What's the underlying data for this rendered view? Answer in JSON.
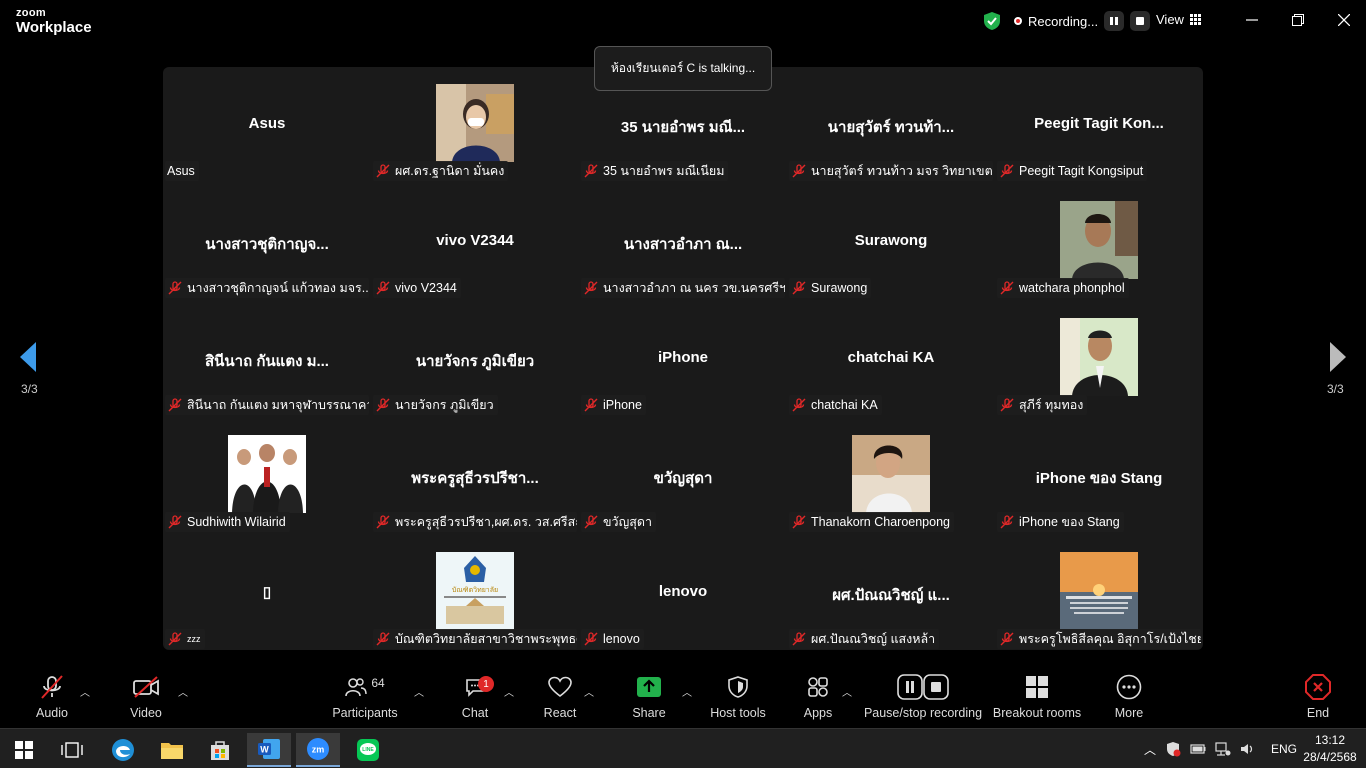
{
  "app": {
    "brand_top": "zoom",
    "brand_bottom": "Workplace"
  },
  "titlebar": {
    "recording_label": "Recording...",
    "view_label": "View"
  },
  "talking": "ห้องเรียนเตอร์ C is talking...",
  "pager": {
    "left": "3/3",
    "right": "3/3"
  },
  "tiles": [
    {
      "display": "Asus",
      "label": "Asus",
      "muted": false,
      "photo": null
    },
    {
      "display": "",
      "label": "ผศ.ดร.ฐานิดา มั่นคง",
      "muted": true,
      "photo": "woman-portrait"
    },
    {
      "display": "35 นายอำพร มณี...",
      "label": "35 นายอำพร มณีเนียม",
      "muted": true,
      "photo": null
    },
    {
      "display": "นายสุวัตร์ ทวนท้า...",
      "label": "นายสุวัตร์ ทวนท้าว มจร วิทยาเขต...",
      "muted": true,
      "photo": null
    },
    {
      "display": "Peegit Tagit Kon...",
      "label": "Peegit Tagit Kongsiput",
      "muted": true,
      "photo": null
    },
    {
      "display": "นางสาวชุติกาญจ...",
      "label": "นางสาวชุติกาญจน์ แก้วทอง มจร....",
      "muted": true,
      "photo": null
    },
    {
      "display": "vivo V2344",
      "label": "vivo V2344",
      "muted": true,
      "photo": null
    },
    {
      "display": "นางสาวอำภา ณ...",
      "label": "นางสาวอำภา ณ นคร วข.นครศรีฯ",
      "muted": true,
      "photo": null
    },
    {
      "display": "Surawong",
      "label": "Surawong",
      "muted": true,
      "photo": null
    },
    {
      "display": "",
      "label": "watchara phonphol",
      "muted": true,
      "photo": "man-outdoor"
    },
    {
      "display": "สินีนาถ กันแตง ม...",
      "label": "สินีนาถ กันแตง มหาจุฬาบรรณาคาร",
      "muted": true,
      "photo": null
    },
    {
      "display": "นายวัจกร ภูมิเขียว",
      "label": "นายวัจกร ภูมิเขียว",
      "muted": true,
      "photo": null
    },
    {
      "display": "iPhone",
      "label": "iPhone",
      "muted": true,
      "photo": null
    },
    {
      "display": "chatchai KA",
      "label": "chatchai KA",
      "muted": true,
      "photo": null
    },
    {
      "display": "",
      "label": "สุภีร์ ทุมทอง",
      "muted": true,
      "photo": "man-suit"
    },
    {
      "display": "",
      "label": "Sudhiwith Wilairid",
      "muted": true,
      "photo": "group-photo"
    },
    {
      "display": "พระครูสุธีวรปรีชา...",
      "label": "พระครูสุธีวรปรีชา,ผศ.ดร. วส.ศรีสะ...",
      "muted": true,
      "photo": null
    },
    {
      "display": "ขวัญสุดา",
      "label": "ขวัญสุดา",
      "muted": true,
      "photo": null
    },
    {
      "display": "",
      "label": "Thanakorn Charoenpong",
      "muted": true,
      "photo": "young-man"
    },
    {
      "display": "iPhone ของ Stang",
      "label": "iPhone ของ Stang",
      "muted": true,
      "photo": null
    },
    {
      "display": "▯",
      "label": "zzz",
      "muted": true,
      "photo": null
    },
    {
      "display": "",
      "label": "บัณฑิตวิทยาลัยสาขาวิชาพระพุทธศ...",
      "muted": true,
      "photo": "college-logo"
    },
    {
      "display": "lenovo",
      "label": "lenovo",
      "muted": true,
      "photo": null
    },
    {
      "display": "ผศ.ปัณณวิชญ์ แ...",
      "label": "ผศ.ปัณณวิชญ์ แสงหล้า",
      "muted": true,
      "photo": null
    },
    {
      "display": "",
      "label": "พระครูโพธิสีลคุณ อิสุกาโร/เป้งไชยโม, ด...",
      "muted": true,
      "photo": "sunset-quote"
    }
  ],
  "toolbar": {
    "audio": "Audio",
    "video": "Video",
    "participants": "Participants",
    "participants_count": "64",
    "chat": "Chat",
    "chat_badge": "1",
    "react": "React",
    "share": "Share",
    "host_tools": "Host tools",
    "apps": "Apps",
    "pause_stop": "Pause/stop recording",
    "breakout": "Breakout rooms",
    "more": "More",
    "end": "End"
  },
  "taskbar": {
    "lang": "ENG",
    "time": "13:12",
    "date": "28/4/2568"
  },
  "colors": {
    "bg": "#000000",
    "tile_bg": "#1a1a1a",
    "accent_green": "#22b14c",
    "end_red": "#e02828",
    "nav_blue": "#3d9bea"
  }
}
